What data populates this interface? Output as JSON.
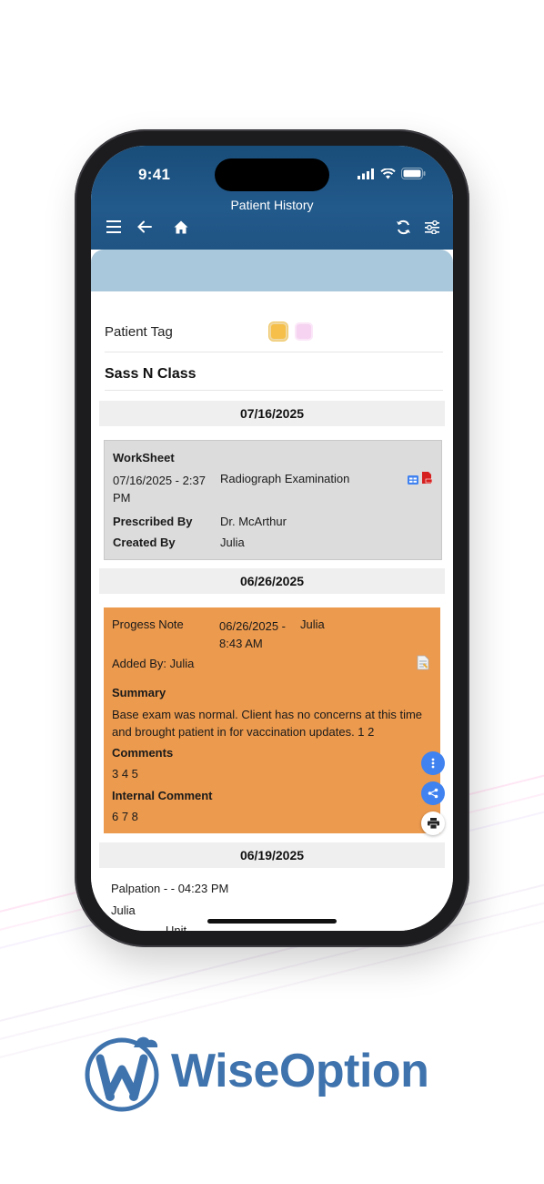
{
  "status_bar": {
    "time": "9:41"
  },
  "header": {
    "title": "Patient History"
  },
  "patient": {
    "tag_label": "Patient Tag",
    "tag_colors": [
      "#f5bf4a",
      "#f5d3f1"
    ],
    "name": "Sass N Class"
  },
  "entries": [
    {
      "date": "07/16/2025",
      "type": "WorkSheet",
      "datetime": "07/16/2025 - 2:37 PM",
      "description": "Radiograph Examination",
      "prescribed_by_label": "Prescribed By",
      "prescribed_by": "Dr. McArthur",
      "created_by_label": "Created By",
      "created_by": "Julia"
    },
    {
      "date": "06/26/2025",
      "type": "Progess Note",
      "datetime": "06/26/2025 - 8:43 AM",
      "author": "Julia",
      "added_by": "Added By: Julia",
      "summary_label": "Summary",
      "summary": "Base exam was normal. Client has no concerns at this time and brought patient in for vaccination updates. 1 2",
      "comments_label": "Comments",
      "comments": "3 4 5",
      "internal_comment_label": "Internal Comment",
      "internal_comment": "6 7 8"
    },
    {
      "date": "06/19/2025",
      "line1": "Palpation - - 04:23 PM",
      "line2": "Julia",
      "line3_partial": "Unit"
    }
  ],
  "brand": {
    "name": "WiseOption",
    "colors": {
      "primary": "#3f73ad",
      "header": "#1f5483",
      "worksheet_bg": "#dcdcdc",
      "note_bg": "#ec9a4e",
      "fab": "#3f82f0"
    }
  },
  "icons": [
    "menu-icon",
    "back-arrow-icon",
    "home-icon",
    "refresh-icon",
    "filter-sliders-icon",
    "worksheet-icon",
    "pdf-icon",
    "document-icon",
    "more-vertical-icon",
    "share-icon",
    "print-icon",
    "signal-icon",
    "wifi-icon",
    "battery-icon"
  ]
}
